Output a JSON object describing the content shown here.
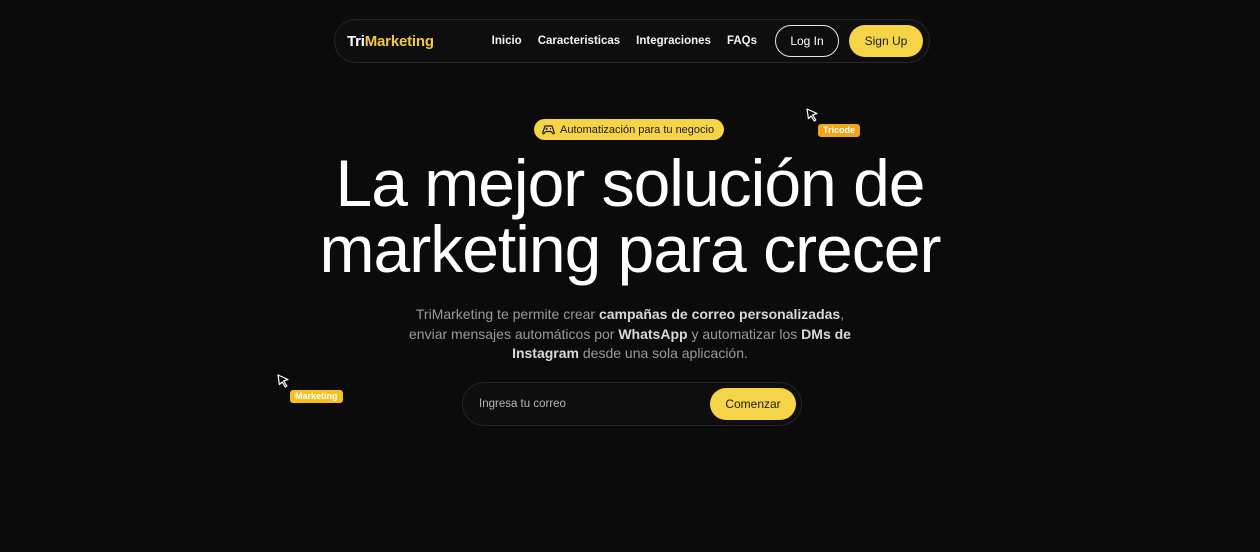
{
  "navbar": {
    "logo_part1": "Tri",
    "logo_part2": "Marketing",
    "links": [
      "Inicio",
      "Caracteristicas",
      "Integraciones",
      "FAQs"
    ],
    "login_label": "Log In",
    "signup_label": "Sign Up"
  },
  "badge": {
    "icon": "gamepad-icon",
    "label": "Automatización para tu negocio"
  },
  "cursors": {
    "tricode_label": "Tricode",
    "marketing_label": "Marketing"
  },
  "hero": {
    "title_line1": "La mejor solución de",
    "title_line2": "marketing para crecer",
    "desc": {
      "p1": "TriMarketing te permite crear ",
      "b1": "campañas de correo personalizadas",
      "p2": ", enviar mensajes automáticos por ",
      "b2": "WhatsApp",
      "p3": " y automatizar los ",
      "b3": "DMs de Instagram",
      "p4": " desde una sola aplicación."
    }
  },
  "signup": {
    "email_placeholder": "Ingresa tu correo",
    "button_label": "Comenzar"
  },
  "colors": {
    "background": "#0b0b0b",
    "accent": "#f5d547",
    "tag_orange": "#f1a51b"
  }
}
